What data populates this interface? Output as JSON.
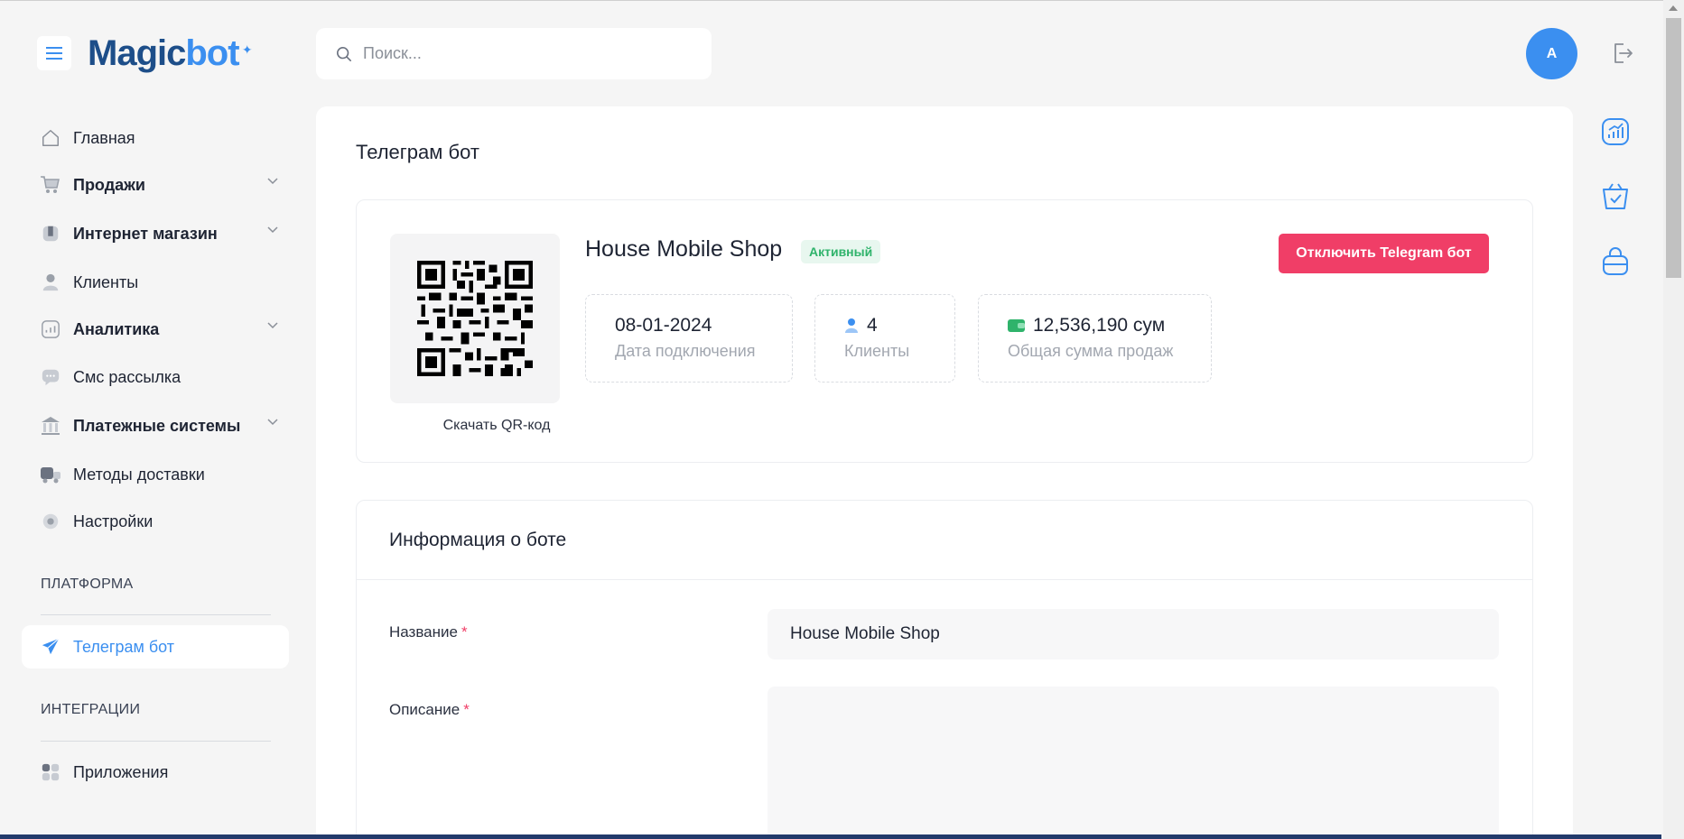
{
  "app": {
    "logo_part1": "Magic",
    "logo_part2": "bot"
  },
  "search": {
    "placeholder": "Поиск..."
  },
  "user": {
    "avatar_initial": "A"
  },
  "sidebar": {
    "items": [
      {
        "label": "Главная"
      },
      {
        "label": "Продажи"
      },
      {
        "label": "Интернет магазин"
      },
      {
        "label": "Клиенты"
      },
      {
        "label": "Аналитика"
      },
      {
        "label": "Смс рассылка"
      },
      {
        "label": "Платежные системы"
      },
      {
        "label": "Методы доставки"
      },
      {
        "label": "Настройки"
      }
    ],
    "section_platform": "ПЛАТФОРМА",
    "telegram_bot": "Телеграм бот",
    "section_integrations": "ИНТЕГРАЦИИ",
    "apps": "Приложения"
  },
  "page": {
    "title": "Телеграм бот",
    "bot": {
      "name": "House Mobile Shop",
      "status": "Активный",
      "disable_button": "Отключить Telegram бот",
      "qr_download": "Скачать QR-код",
      "stats": {
        "connected_date": "08-01-2024",
        "connected_label": "Дата подключения",
        "clients_count": "4",
        "clients_label": "Клиенты",
        "sales_total": "12,536,190 сум",
        "sales_label": "Общая сумма продаж"
      }
    },
    "info": {
      "title": "Информация о боте",
      "name_label": "Название",
      "name_value": "House Mobile Shop",
      "required_mark": "*",
      "description_label": "Описание",
      "description_value": ""
    }
  },
  "colors": {
    "accent": "#3b8ff0",
    "danger": "#f03e67",
    "success": "#2fb36b",
    "brand_dark": "#1d4e89"
  }
}
